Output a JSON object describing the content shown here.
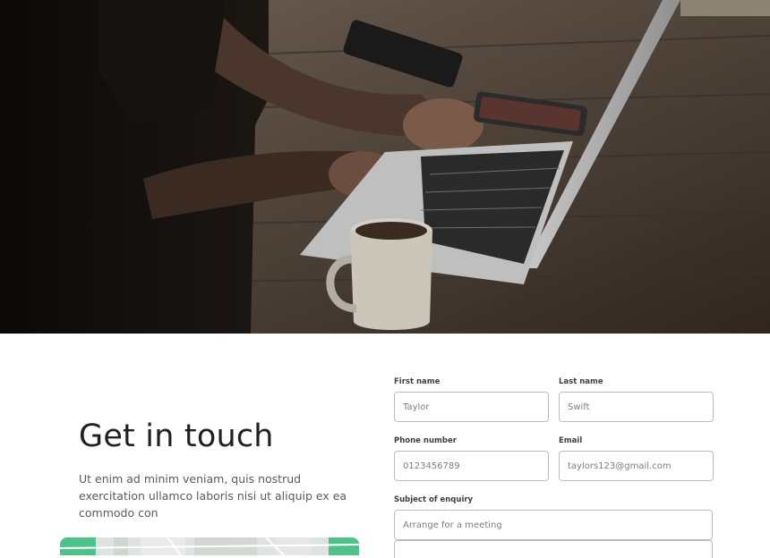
{
  "contact": {
    "title": "Get in touch",
    "description": "Ut enim ad minim veniam, quis nostrud exercitation ullamco laboris nisi ut aliquip ex ea commodo con"
  },
  "form": {
    "first_name": {
      "label": "First name",
      "placeholder": "Taylor"
    },
    "last_name": {
      "label": "Last name",
      "placeholder": "Swift"
    },
    "phone": {
      "label": "Phone number",
      "placeholder": "0123456789"
    },
    "email": {
      "label": "Email",
      "placeholder": "taylors123@gmail.com"
    },
    "subject": {
      "label": "Subject of enquiry",
      "placeholder": "Arrange for a meeting"
    }
  },
  "colors": {
    "page_bg": "#ffffff",
    "heading": "#202124",
    "input_border": "#b8bcc2"
  }
}
